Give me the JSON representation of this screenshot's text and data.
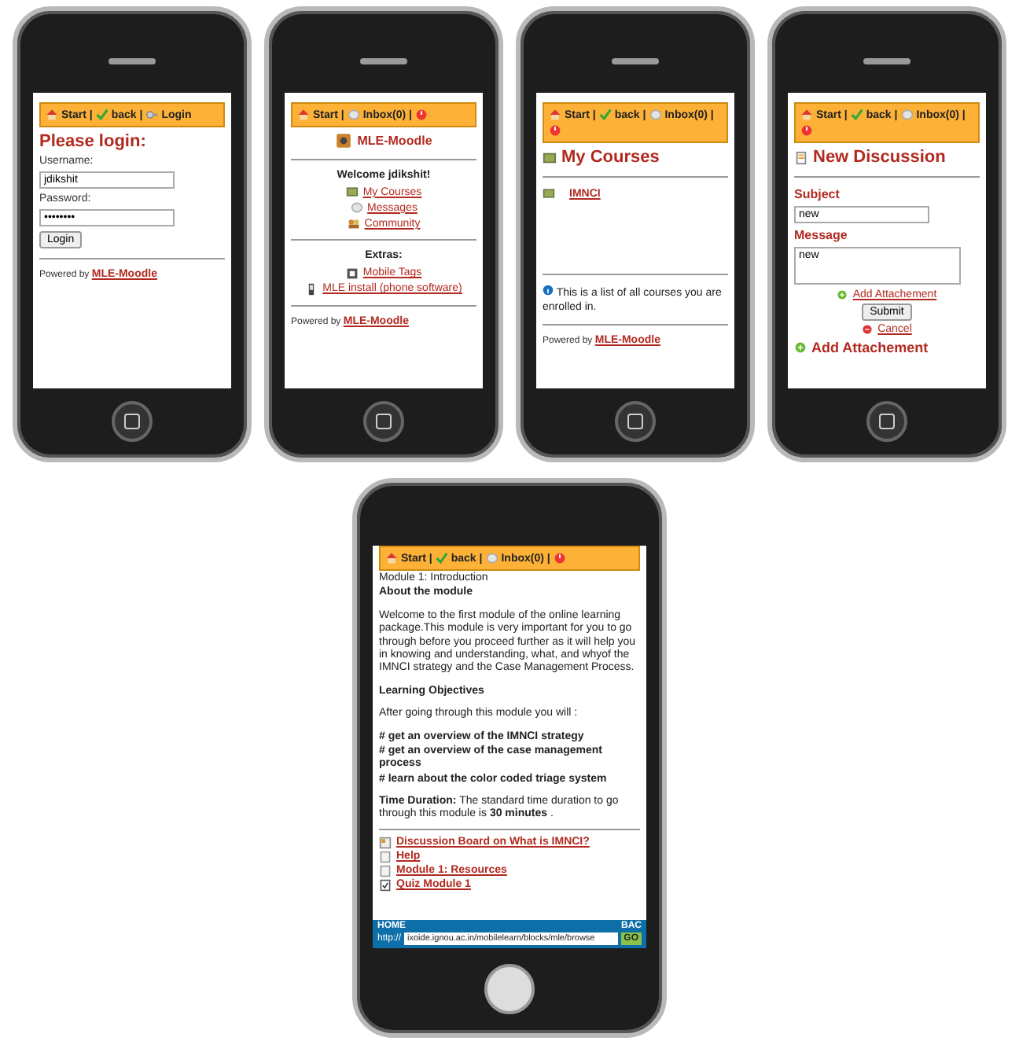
{
  "screens": [
    {
      "kind": "login",
      "nav": [
        {
          "kind": "house",
          "label": "Start |"
        },
        {
          "kind": "check",
          "label": "back |"
        },
        {
          "kind": "key",
          "label": "Login"
        }
      ],
      "heading": "Please login:",
      "username_label": "Username:",
      "username": "jdikshit",
      "password_label": "Password:",
      "password": "••••••••",
      "button": "Login",
      "footer": "Powered by",
      "footer_link": "MLE-Moodle"
    },
    {
      "kind": "home",
      "nav": [
        {
          "kind": "house",
          "label": "Start |"
        },
        {
          "kind": "bubble",
          "label": "Inbox(0) |"
        },
        {
          "kind": "power"
        }
      ],
      "logo": "MLE-Moodle",
      "welcome": "Welcome jdikshit!",
      "links": [
        {
          "kind": "course",
          "label": "My Courses"
        },
        {
          "kind": "bubble",
          "label": "Messages"
        },
        {
          "kind": "community",
          "label": "Community"
        }
      ],
      "extras_title": "Extras:",
      "extras": [
        {
          "kind": "tag",
          "label": "Mobile Tags"
        },
        {
          "kind": "phone",
          "label": "MLE install (phone software)"
        }
      ],
      "footer": "Powered by",
      "footer_link": "MLE-Moodle"
    },
    {
      "kind": "courses",
      "nav": [
        {
          "kind": "house",
          "label": "Start |"
        },
        {
          "kind": "check",
          "label": "back |"
        },
        {
          "kind": "bubble",
          "label": "Inbox(0) |"
        },
        {
          "kind": "power"
        }
      ],
      "heading": "My Courses",
      "courses": [
        "IMNCI"
      ],
      "info": "This is a list of all courses you are enrolled in.",
      "footer": "Powered by",
      "footer_link": "MLE-Moodle"
    },
    {
      "kind": "discussion",
      "nav": [
        {
          "kind": "house",
          "label": "Start |"
        },
        {
          "kind": "check",
          "label": "back |"
        },
        {
          "kind": "bubble",
          "label": "Inbox(0) |"
        },
        {
          "kind": "power"
        }
      ],
      "heading": "New Discussion",
      "subject_label": "Subject",
      "subject": "new",
      "message_label": "Message",
      "message": "new",
      "attach_link": "Add Attachement",
      "submit": "Submit",
      "cancel": "Cancel",
      "attach_heading": "Add Attachement"
    }
  ],
  "module": {
    "nav": [
      {
        "kind": "house",
        "label": "Start |"
      },
      {
        "kind": "check",
        "label": "back |"
      },
      {
        "kind": "bubble",
        "label": "Inbox(0) |"
      },
      {
        "kind": "power"
      }
    ],
    "title": "Module 1: Introduction",
    "about": "About the module",
    "intro": "Welcome to the first module of the online learning package.This module is very important for you to go through before you proceed further as it will help you in knowing and understanding, what, and whyof the IMNCI strategy and the Case Management Process.",
    "objectives_title": "Learning Objectives",
    "objectives_lead": "After going through this module you will :",
    "objectives": [
      "# get an overview of the IMNCI strategy",
      "# get an overview of the case management process",
      "# learn about the color coded triage system"
    ],
    "duration": "**Time Duration:** The standard time duration to go through this module is **30 minutes** .",
    "links": [
      {
        "kind": "forum",
        "label": "Discussion Board on What is IMNCI?"
      },
      {
        "kind": "page",
        "label": "Help"
      },
      {
        "kind": "page",
        "label": "Module 1: Resources"
      },
      {
        "kind": "quiz",
        "label": "Quiz Module 1"
      }
    ],
    "browser": {
      "home": "HOME",
      "back": "BAC",
      "scheme": "http://",
      "url": "ixoide.ignou.ac.in/mobilelearn/blocks/mle/browse",
      "go": "GO"
    }
  }
}
